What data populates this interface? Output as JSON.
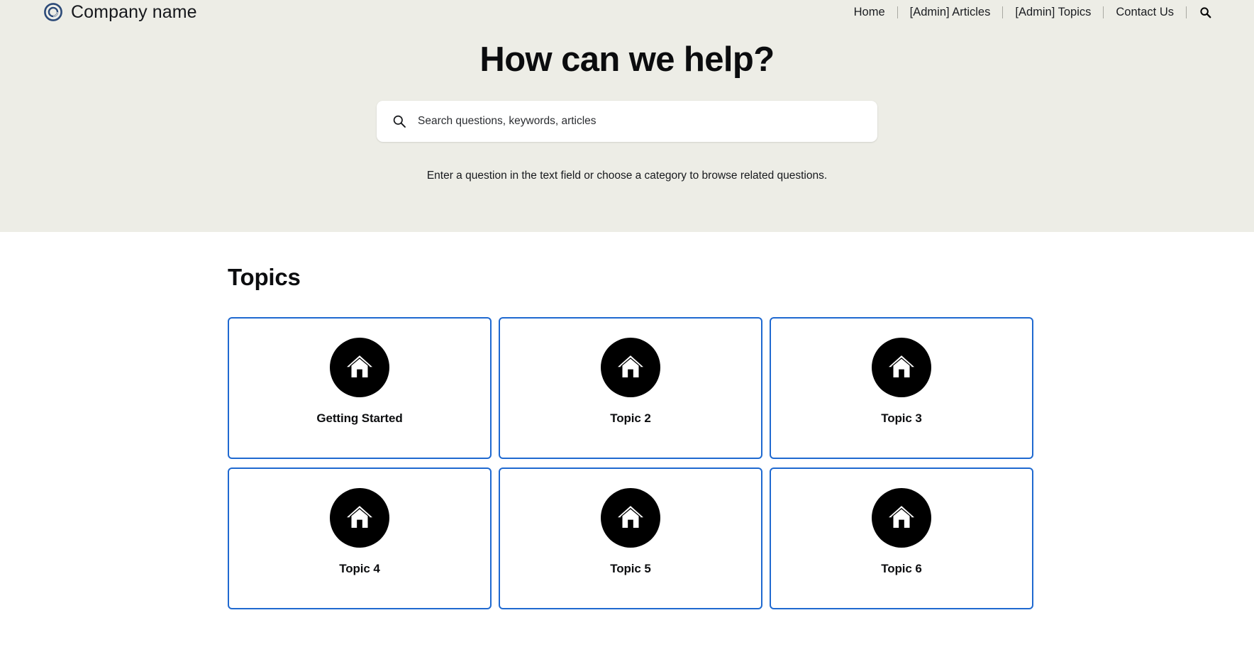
{
  "header": {
    "brand": {
      "logo_icon": "spiral-circle-logo",
      "logo_color": "#2c4a78",
      "name": "Company name"
    },
    "nav_links": [
      {
        "label": "Home"
      },
      {
        "label": "[Admin] Articles"
      },
      {
        "label": "[Admin] Topics"
      },
      {
        "label": "Contact Us"
      }
    ],
    "search_icon": "search-icon"
  },
  "hero": {
    "background_color": "#edede6",
    "title": "How can we help?",
    "search": {
      "icon": "search-icon",
      "value": "",
      "placeholder": "Search questions, keywords, articles"
    },
    "subtitle": "Enter a question in the text field or choose a category to browse related questions."
  },
  "main": {
    "topics_heading": "Topics",
    "card_border_color": "#1f69d0",
    "card_icon_bg": "#000000",
    "topics": [
      {
        "label": "Getting Started",
        "icon": "home-icon"
      },
      {
        "label": "Topic 2",
        "icon": "home-icon"
      },
      {
        "label": "Topic 3",
        "icon": "home-icon"
      },
      {
        "label": "Topic 4",
        "icon": "home-icon"
      },
      {
        "label": "Topic 5",
        "icon": "home-icon"
      },
      {
        "label": "Topic 6",
        "icon": "home-icon"
      }
    ]
  }
}
